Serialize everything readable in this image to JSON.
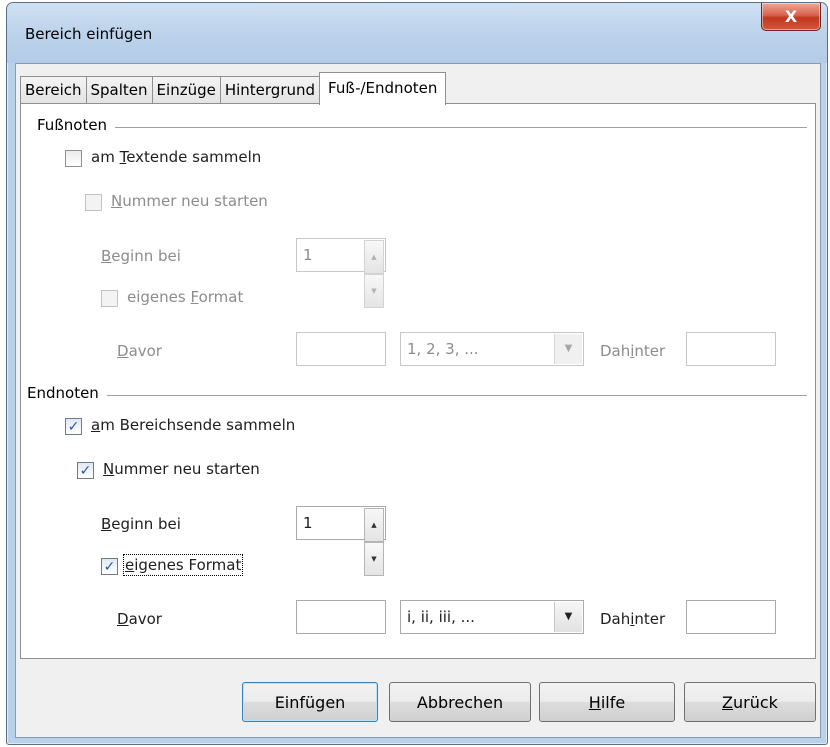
{
  "window": {
    "title": "Bereich einfügen",
    "close_glyph": "X"
  },
  "tabs": [
    {
      "label": "Bereich"
    },
    {
      "label": "Spalten"
    },
    {
      "label": "Einzüge"
    },
    {
      "label": "Hintergrund"
    },
    {
      "label": "Fuß-/Endnoten",
      "active": true
    }
  ],
  "footnotes": {
    "section_title": "Fußnoten",
    "collect_pre": "am ",
    "collect_u": "T",
    "collect_post": "extende sammeln",
    "collect_checked": false,
    "restart_pre": "",
    "restart_u": "N",
    "restart_post": "ummer neu starten",
    "restart_checked": false,
    "start_pre": "",
    "start_u": "B",
    "start_post": "eginn bei",
    "start_value": "1",
    "own_format_pre": "eigenes ",
    "own_format_u": "F",
    "own_format_post": "ormat",
    "own_format_checked": false,
    "before_pre": "",
    "before_u": "D",
    "before_post": "avor",
    "before_value": "",
    "format_value": "1, 2, 3, ...",
    "after_pre": "Dah",
    "after_u": "i",
    "after_post": "nter",
    "after_value": ""
  },
  "endnotes": {
    "section_title": "Endnoten",
    "collect_pre": "",
    "collect_u": "a",
    "collect_post": "m Bereichsende sammeln",
    "collect_checked": true,
    "restart_pre": "",
    "restart_u": "N",
    "restart_post": "ummer neu starten",
    "restart_checked": true,
    "start_pre": "",
    "start_u": "B",
    "start_post": "eginn bei",
    "start_value": "1",
    "own_format_pre": "",
    "own_format_u": "e",
    "own_format_post": "igenes Format",
    "own_format_checked": true,
    "before_pre": "",
    "before_u": "D",
    "before_post": "avor",
    "before_value": "",
    "format_value": "i, ii, iii, ...",
    "after_pre": "Dah",
    "after_u": "i",
    "after_post": "nter",
    "after_value": ""
  },
  "buttons": {
    "insert": "Einfügen",
    "cancel": "Abbrechen",
    "help_u": "H",
    "help_post": "ilfe",
    "back_u": "Z",
    "back_post": "urück"
  },
  "icons": {
    "check": "✓",
    "spin_up": "▲",
    "spin_down": "▼",
    "dropdown": "▼"
  }
}
